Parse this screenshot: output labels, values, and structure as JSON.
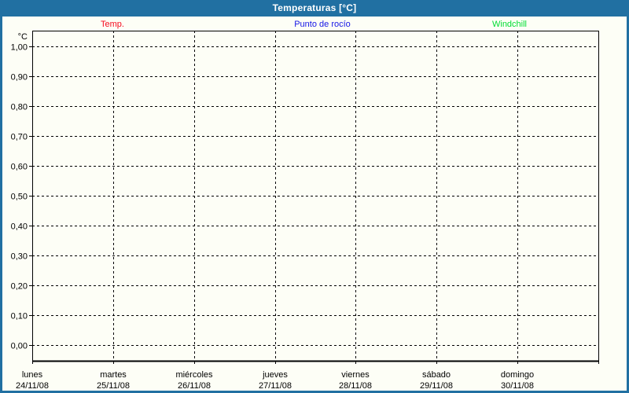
{
  "window": {
    "title": "Temperaturas [°C]"
  },
  "colors": {
    "frame": "#2170a2",
    "background": "#fdfef6",
    "plot_border": "#000000",
    "grid": "#000000",
    "axis_text": "#000000",
    "temp": "#f50b1e",
    "dew_point": "#1414e6",
    "windchill": "#00dd33"
  },
  "chart_data": {
    "type": "line",
    "title": "Temperaturas [°C]",
    "ylabel": "°C",
    "ylim": [
      0,
      1
    ],
    "y_tick_labels": [
      "1,00",
      "0,90",
      "0,80",
      "0,70",
      "0,60",
      "0,50",
      "0,40",
      "0,30",
      "0,20",
      "0,10",
      "0,00"
    ],
    "y_tick_values": [
      1.0,
      0.9,
      0.8,
      0.7,
      0.6,
      0.5,
      0.4,
      0.3,
      0.2,
      0.1,
      0.0
    ],
    "grid": "dashed",
    "legend_position": "top",
    "x_categories": [
      {
        "day": "lunes",
        "date": "24/11/08"
      },
      {
        "day": "martes",
        "date": "25/11/08"
      },
      {
        "day": "miércoles",
        "date": "26/11/08"
      },
      {
        "day": "jueves",
        "date": "27/11/08"
      },
      {
        "day": "viernes",
        "date": "28/11/08"
      },
      {
        "day": "sábado",
        "date": "29/11/08"
      },
      {
        "day": "domingo",
        "date": "30/11/08"
      }
    ],
    "series": [
      {
        "name": "Temp.",
        "color": "#f50b1e",
        "values": []
      },
      {
        "name": "Punto de rocío",
        "color": "#1414e6",
        "values": []
      },
      {
        "name": "Windchill",
        "color": "#00dd33",
        "values": []
      }
    ]
  }
}
